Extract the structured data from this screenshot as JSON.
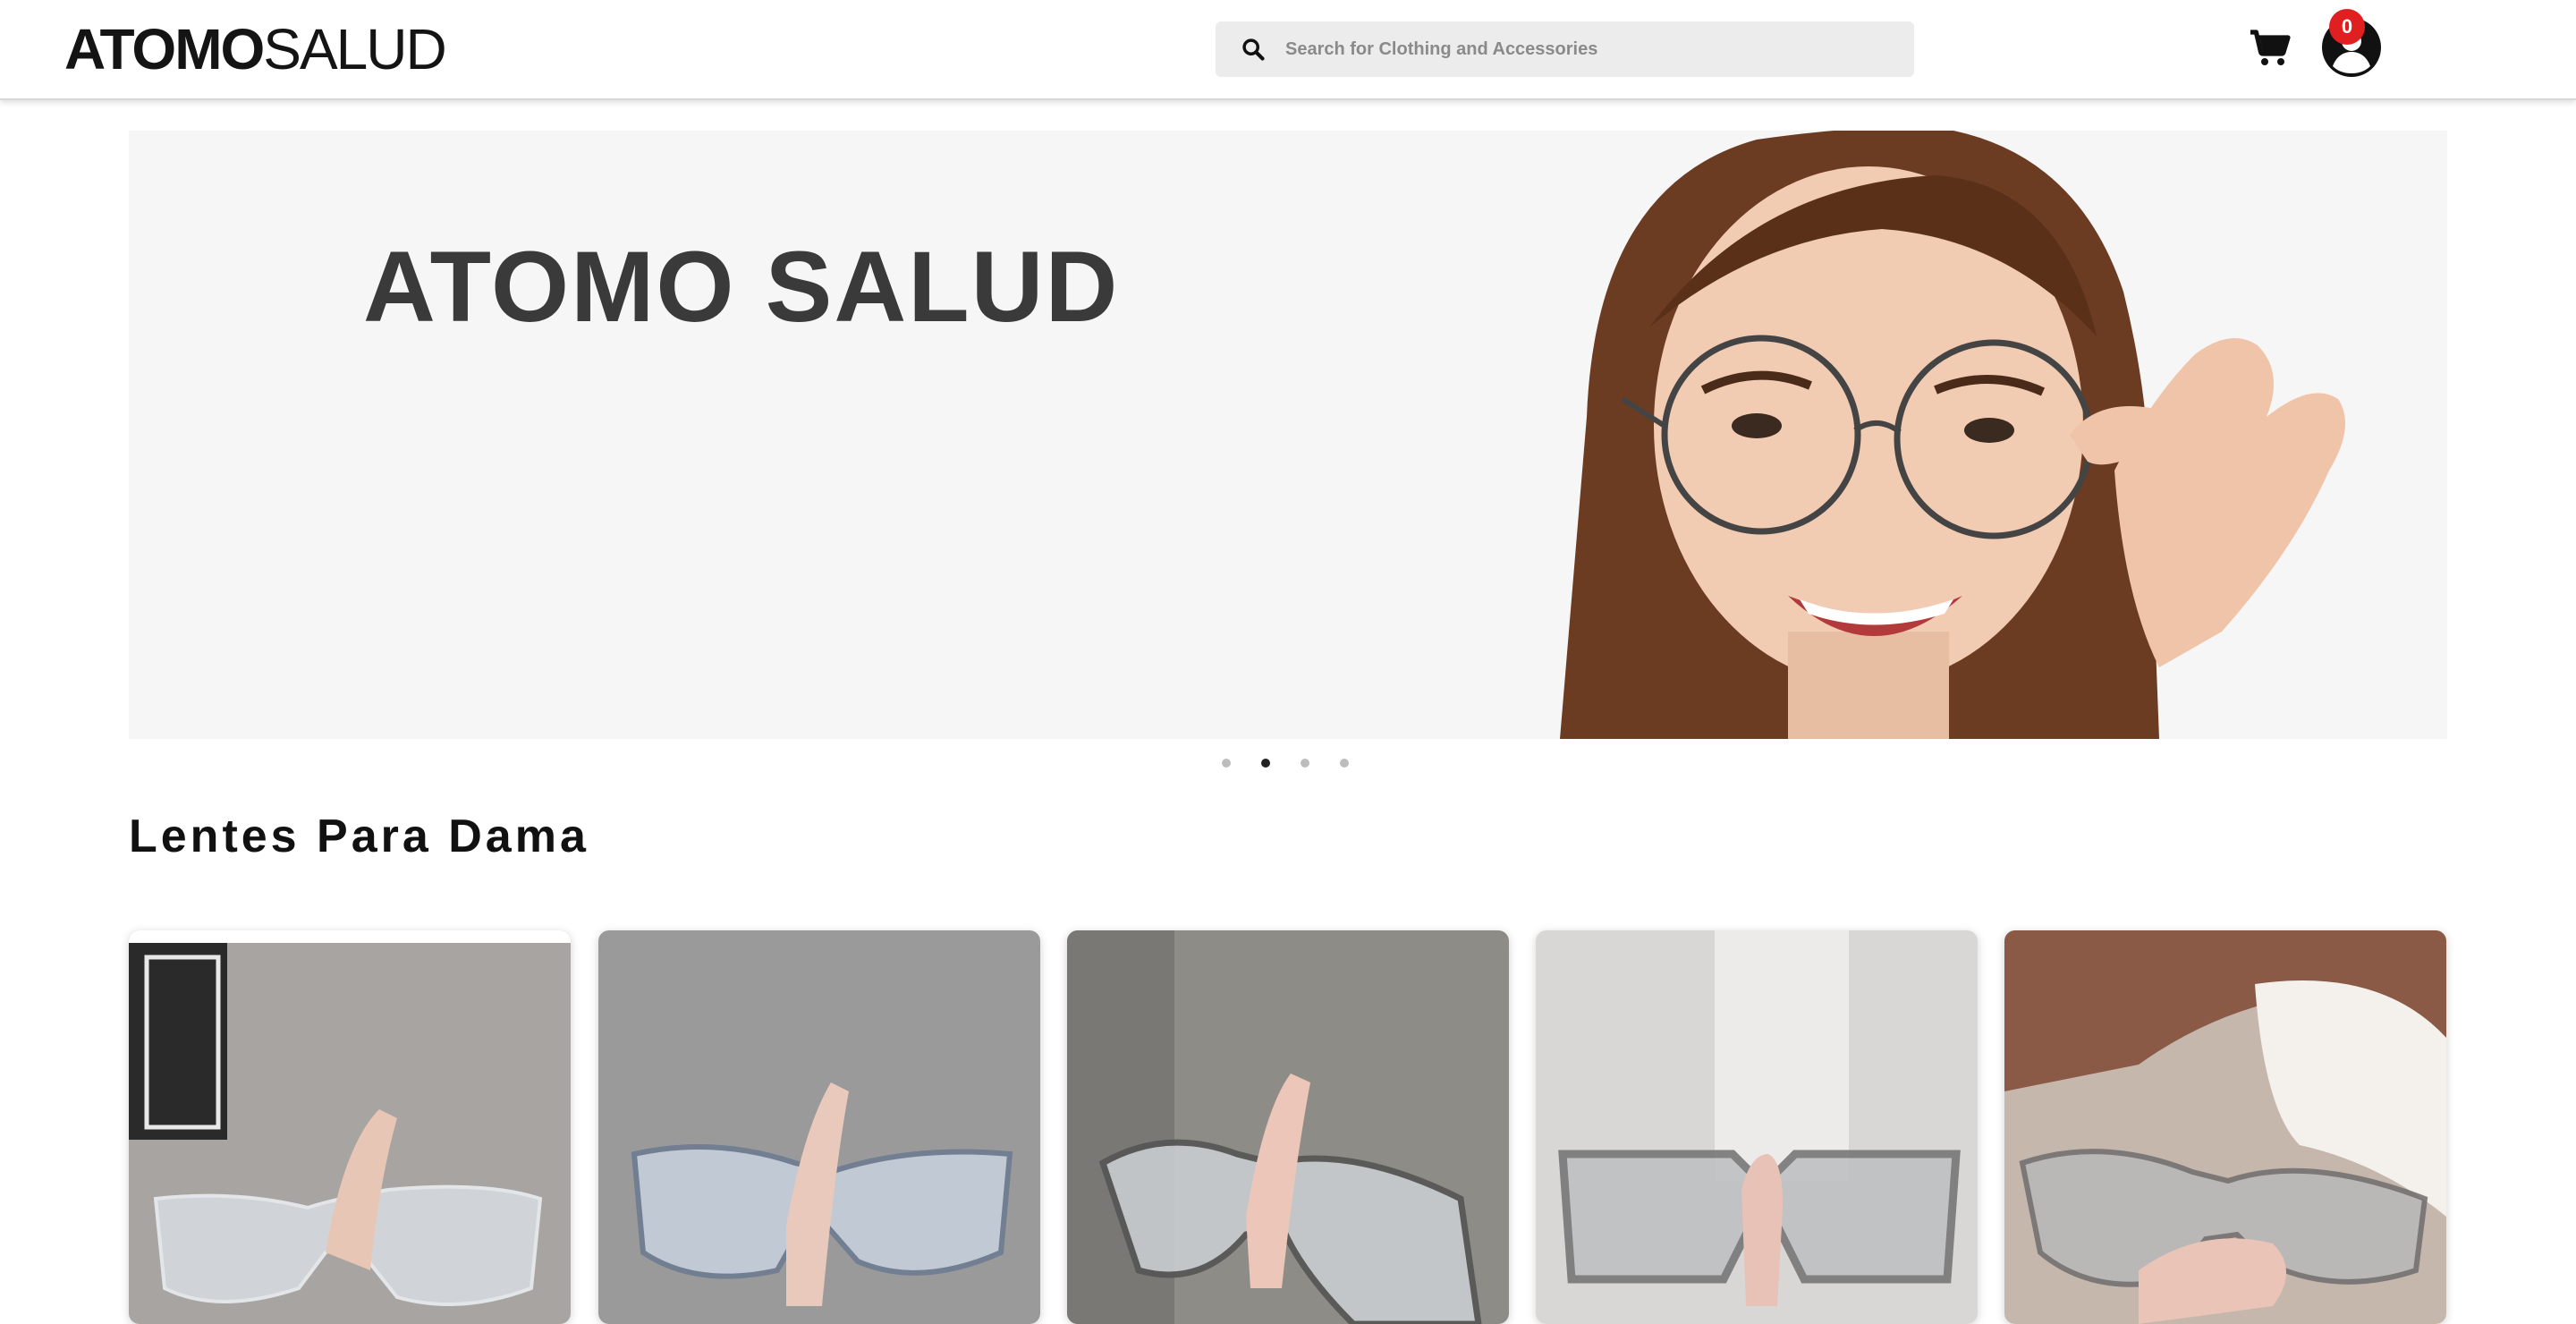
{
  "header": {
    "logo_bold": "ATOMO",
    "logo_light": "SALUD",
    "search_placeholder": "Search for Clothing and Accessories",
    "cart_count": "0"
  },
  "hero": {
    "title": "ATOMO SALUD",
    "slides": 4,
    "active_slide": 2
  },
  "section": {
    "title": "Lentes Para Dama"
  },
  "colors": {
    "badge": "#e02020",
    "text": "#141414"
  }
}
